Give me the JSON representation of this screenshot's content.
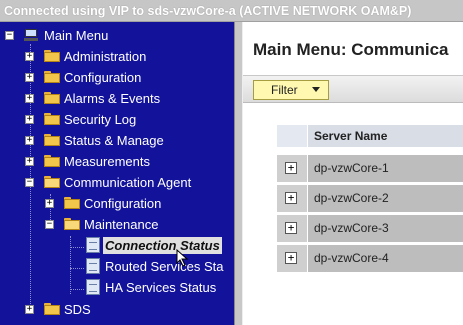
{
  "banner": {
    "text": "Connected using VIP to sds-vzwCore-a (ACTIVE NETWORK OAM&P)"
  },
  "nav": {
    "root": {
      "label": "Main Menu",
      "expander": "−",
      "icon": "computer-icon"
    },
    "items": [
      {
        "label": "Administration",
        "expander": "+",
        "icon": "folder-icon"
      },
      {
        "label": "Configuration",
        "expander": "+",
        "icon": "folder-icon"
      },
      {
        "label": "Alarms & Events",
        "expander": "+",
        "icon": "folder-icon"
      },
      {
        "label": "Security Log",
        "expander": "+",
        "icon": "folder-icon"
      },
      {
        "label": "Status & Manage",
        "expander": "+",
        "icon": "folder-icon"
      },
      {
        "label": "Measurements",
        "expander": "+",
        "icon": "folder-icon"
      },
      {
        "label": "Communication Agent",
        "expander": "−",
        "icon": "folder-open-icon"
      },
      {
        "label": "Configuration",
        "expander": "+",
        "icon": "folder-icon"
      },
      {
        "label": "Maintenance",
        "expander": "−",
        "icon": "folder-open-icon"
      },
      {
        "label": "Connection Status",
        "icon": "document-icon",
        "selected": true
      },
      {
        "label": "Routed Services Sta",
        "icon": "document-icon"
      },
      {
        "label": "HA Services Status",
        "icon": "document-icon"
      },
      {
        "label": "SDS",
        "expander": "+",
        "icon": "folder-icon"
      }
    ]
  },
  "main": {
    "title": "Main Menu: Communica",
    "filter_label": "Filter",
    "table": {
      "header": "Server Name",
      "rows": [
        {
          "expander": "+",
          "name": "dp-vzwCore-1"
        },
        {
          "expander": "+",
          "name": "dp-vzwCore-2"
        },
        {
          "expander": "+",
          "name": "dp-vzwCore-3"
        },
        {
          "expander": "+",
          "name": "dp-vzwCore-4"
        }
      ]
    }
  },
  "colors": {
    "nav_background": "#12129a",
    "banner_background": "#c6c6c6",
    "filter_button": "#fff8b0"
  }
}
